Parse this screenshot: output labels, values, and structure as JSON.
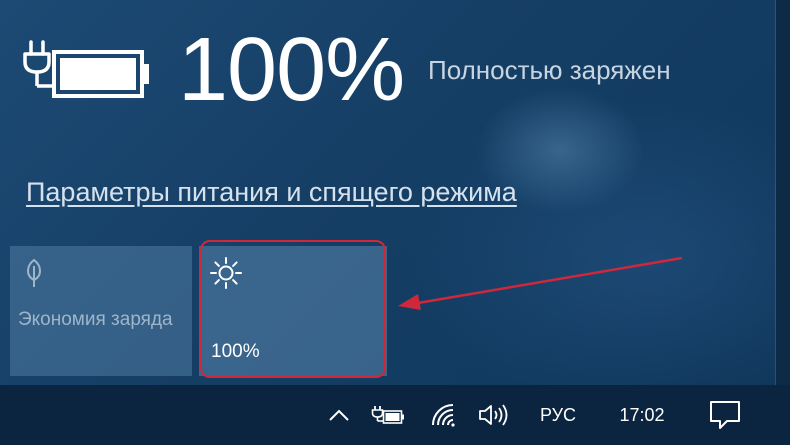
{
  "battery": {
    "percent": "100%",
    "status": "Полностью заряжен",
    "icon": "battery-plugged-icon"
  },
  "power_link": "Параметры питания и спящего режима",
  "tiles": {
    "battery_saver": {
      "label": "Экономия заряда",
      "icon": "leaf-icon"
    },
    "brightness": {
      "value": "100%",
      "icon": "sun-icon"
    }
  },
  "annotation": {
    "color": "#d0283a"
  },
  "taskbar": {
    "chevron_icon": "chevron-up-icon",
    "battery_icon": "battery-plugged-icon",
    "wifi_icon": "wifi-icon",
    "volume_icon": "volume-icon",
    "language": "РУС",
    "time": "17:02",
    "action_center_icon": "action-center-icon"
  }
}
